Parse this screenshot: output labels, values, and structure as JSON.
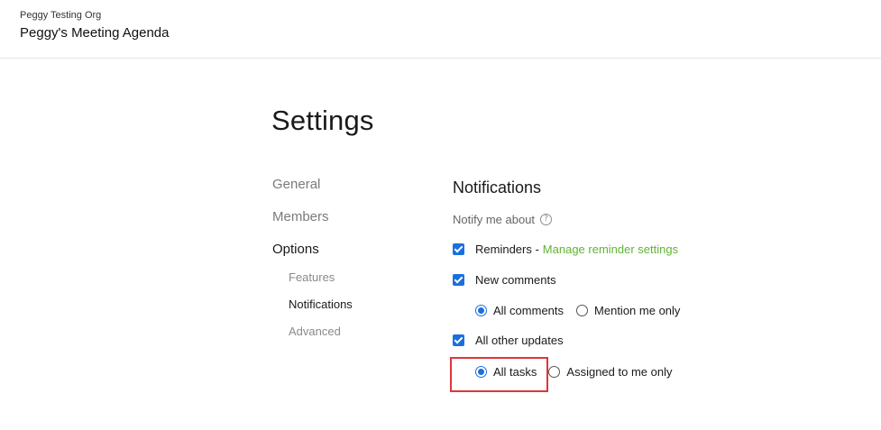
{
  "header": {
    "org_name": "Peggy Testing Org",
    "board_name": "Peggy's Meeting Agenda"
  },
  "page": {
    "title": "Settings"
  },
  "nav": {
    "items": [
      {
        "label": "General",
        "active": false
      },
      {
        "label": "Members",
        "active": false
      },
      {
        "label": "Options",
        "active": true
      }
    ],
    "sub_items": [
      {
        "label": "Features",
        "active": false
      },
      {
        "label": "Notifications",
        "active": true
      },
      {
        "label": "Advanced",
        "active": false
      }
    ]
  },
  "notifications": {
    "title": "Notifications",
    "notify_label": "Notify me about",
    "help_icon": "?",
    "reminders": {
      "label": "Reminders -",
      "link": "Manage reminder settings",
      "checked": true
    },
    "new_comments": {
      "label": "New comments",
      "checked": true,
      "options": [
        {
          "label": "All comments",
          "selected": true
        },
        {
          "label": "Mention me only",
          "selected": false
        }
      ]
    },
    "other_updates": {
      "label": "All other updates",
      "checked": true,
      "options": [
        {
          "label": "All tasks",
          "selected": true
        },
        {
          "label": "Assigned to me only",
          "selected": false
        }
      ]
    }
  },
  "colors": {
    "accent": "#1a6fe0",
    "link": "#5fb534",
    "highlight": "#e0353a"
  }
}
